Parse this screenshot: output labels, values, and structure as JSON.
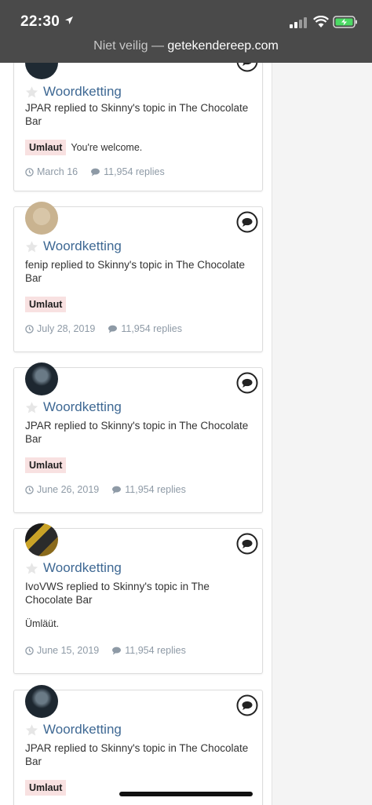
{
  "status_bar": {
    "time": "22:30",
    "url_prefix": "Niet veilig — ",
    "url_domain": "getekendereep.com"
  },
  "colors": {
    "link": "#3e6893",
    "tag_bg": "#f8e1e1",
    "meta": "#8e9aa6",
    "status_bar_bg": "#4a4a4a"
  },
  "feed": [
    {
      "title": "Woordketting",
      "activity": "JPAR replied to Skinny's topic in The Chocolate Bar",
      "tag": "Umlaut",
      "snippet": "You're welcome.",
      "date": "March 16",
      "replies": "11,954 replies"
    },
    {
      "title": "Woordketting",
      "activity": "fenip replied to Skinny's topic in The Chocolate Bar",
      "tag": "Umlaut",
      "snippet": "",
      "date": "July 28, 2019",
      "replies": "11,954 replies"
    },
    {
      "title": "Woordketting",
      "activity": "JPAR replied to Skinny's topic in The Chocolate Bar",
      "tag": "Umlaut",
      "snippet": "",
      "date": "June 26, 2019",
      "replies": "11,954 replies"
    },
    {
      "title": "Woordketting",
      "activity": "IvoVWS replied to Skinny's topic in The Chocolate Bar",
      "tag": "",
      "snippet": "Ümläüt.",
      "date": "June 15, 2019",
      "replies": "11,954 replies"
    },
    {
      "title": "Woordketting",
      "activity": "JPAR replied to Skinny's topic in The Chocolate Bar",
      "tag": "Umlaut",
      "snippet": "",
      "date": "",
      "replies": ""
    }
  ]
}
